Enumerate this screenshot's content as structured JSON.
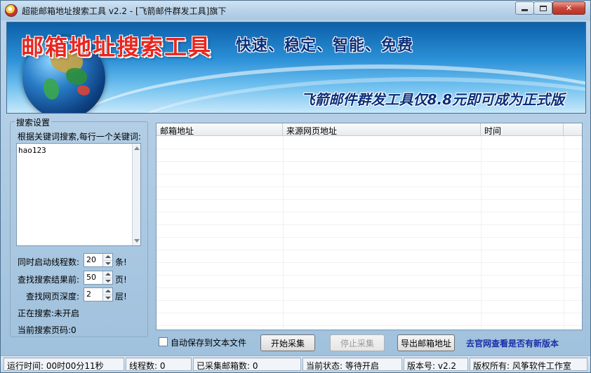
{
  "window": {
    "title": "超能邮箱地址搜索工具 v2.2 - [飞箭邮件群发工具]旗下"
  },
  "banner": {
    "title": "邮箱地址搜索工具",
    "slogan": "快速、稳定、智能、免费",
    "promo": "飞箭邮件群发工具仅8.8元即可成为正式版"
  },
  "search_settings": {
    "group_title": "搜索设置",
    "keyword_label": "根据关键词搜索,每行一个关键词:",
    "keywords_value": "hao123",
    "threads_label": "同时启动线程数:",
    "threads_value": "20",
    "threads_unit": "条!",
    "pages_label": "查找搜索结果前:",
    "pages_value": "50",
    "pages_unit": "页!",
    "depth_label": "查找网页深度:",
    "depth_value": "2",
    "depth_unit": "层!",
    "searching_label": "正在搜索:未开启",
    "current_page_label": "当前搜索页码:0"
  },
  "results_table": {
    "columns": [
      "邮箱地址",
      "来源网页地址",
      "时间"
    ]
  },
  "actions": {
    "auto_save_label": "自动保存到文本文件",
    "start_button": "开始采集",
    "stop_button": "停止采集",
    "export_button": "导出邮箱地址",
    "update_link": "去官网查看是否有新版本"
  },
  "status": {
    "runtime": "运行时间: 00时00分11秒",
    "threads": "线程数: 0",
    "collected": "已采集邮箱数: 0",
    "state": "当前状态: 等待开启",
    "version": "版本号: v2.2",
    "copyright": "版权所有: 风筝软件工作室"
  },
  "colors": {
    "banner_title": "#e8261f",
    "link": "#1a2fa8",
    "close_button": "#c9473a"
  }
}
